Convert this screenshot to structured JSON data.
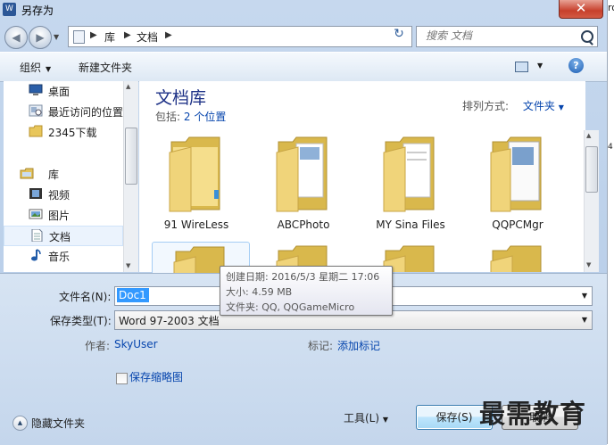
{
  "window": {
    "title": "另存为",
    "close_label": "✕"
  },
  "right_strip": {
    "text_top": "ro",
    "text_mid": "4"
  },
  "address": {
    "crumbs": [
      "库",
      "文档"
    ]
  },
  "search": {
    "placeholder": "搜索 文档"
  },
  "toolbar": {
    "organize": "组织",
    "new_folder": "新建文件夹"
  },
  "nav": {
    "favorites": [
      {
        "label": "桌面",
        "icon": "desktop-icon"
      },
      {
        "label": "最近访问的位置",
        "icon": "recent-places-icon"
      },
      {
        "label": "2345下载",
        "icon": "folder-icon"
      }
    ],
    "library_group": "库",
    "libraries": [
      {
        "label": "视频",
        "icon": "video-library-icon"
      },
      {
        "label": "图片",
        "icon": "pictures-library-icon"
      },
      {
        "label": "文档",
        "icon": "documents-library-icon",
        "selected": true
      },
      {
        "label": "音乐",
        "icon": "music-library-icon"
      }
    ]
  },
  "content": {
    "library_title": "文档库",
    "includes_label": "包括:",
    "includes_link": "2 个位置",
    "arrange_label": "排列方式:",
    "arrange_value": "文件夹",
    "folders": [
      "91 WireLess",
      "ABCPhoto",
      "MY Sina Files",
      "QQPCMgr",
      "",
      "",
      "",
      ""
    ]
  },
  "tooltip": {
    "created": "创建日期: 2016/5/3 星期二 17:06",
    "size": "大小: 4.59 MB",
    "folders": "文件夹: QQ, QQGameMicro"
  },
  "form": {
    "filename_label": "文件名(N):",
    "filename_value": "Doc1",
    "filetype_label": "保存类型(T):",
    "filetype_value": "Word 97-2003 文档",
    "author_label": "作者:",
    "author_value": "SkyUser",
    "tags_label": "标记:",
    "tags_value": "添加标记",
    "thumbnail_label": "保存缩略图",
    "thumbnail_checked": false,
    "hide_folders": "隐藏文件夹",
    "tools": "工具(L)",
    "save": "保存(S)",
    "cancel": "取消"
  },
  "watermark": "最需教育"
}
